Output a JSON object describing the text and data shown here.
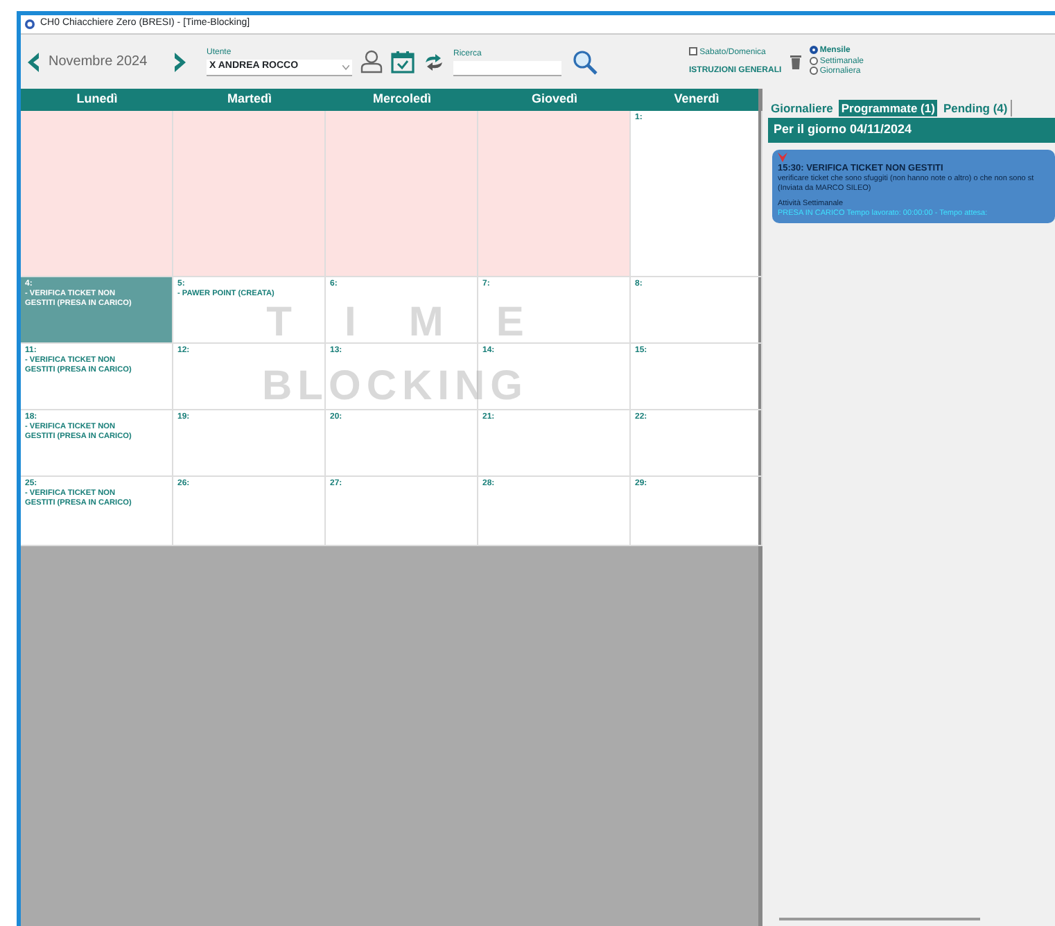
{
  "window": {
    "title": "CH0 Chiacchiere Zero (BRESI) - [Time-Blocking]"
  },
  "toolbar": {
    "month": "Novembre 2024",
    "user_label": "Utente",
    "user_value": "X ANDREA ROCCO",
    "search_label": "Ricerca",
    "weekend": {
      "label": "Sabato/Domenica",
      "checked": false
    },
    "instructions": "ISTRUZIONI GENERALI",
    "views": [
      {
        "label": "Mensile",
        "selected": true
      },
      {
        "label": "Settimanale",
        "selected": false
      },
      {
        "label": "Giornaliera",
        "selected": false
      }
    ]
  },
  "calendar": {
    "weekdays": [
      "Lunedì",
      "Martedì",
      "Mercoledì",
      "Giovedì",
      "Venerdì"
    ],
    "watermark": [
      "TIME",
      "BLOCKING"
    ],
    "weeks": [
      [
        {
          "kind": "other-month"
        },
        {
          "kind": "other-month"
        },
        {
          "kind": "other-month"
        },
        {
          "kind": "other-month"
        },
        {
          "kind": "day",
          "day": "1:",
          "selected": false
        }
      ],
      [
        {
          "kind": "day",
          "day": "4:",
          "entries": [
            "- VERIFICA TICKET NON GESTITI (PRESA IN CARICO)"
          ],
          "selected": true
        },
        {
          "kind": "day",
          "day": "5:",
          "entries": [
            "- PAWER POINT (CREATA)"
          ],
          "selected": false
        },
        {
          "kind": "day",
          "day": "6:",
          "selected": false
        },
        {
          "kind": "day",
          "day": "7:",
          "selected": false
        },
        {
          "kind": "day",
          "day": "8:",
          "selected": false
        }
      ],
      [
        {
          "kind": "day",
          "day": "11:",
          "entries": [
            "- VERIFICA TICKET NON GESTITI (PRESA IN CARICO)"
          ],
          "selected": false
        },
        {
          "kind": "day",
          "day": "12:",
          "selected": false
        },
        {
          "kind": "day",
          "day": "13:",
          "selected": false
        },
        {
          "kind": "day",
          "day": "14:",
          "selected": false
        },
        {
          "kind": "day",
          "day": "15:",
          "selected": false
        }
      ],
      [
        {
          "kind": "day",
          "day": "18:",
          "entries": [
            "- VERIFICA TICKET NON GESTITI (PRESA IN CARICO)"
          ],
          "selected": false
        },
        {
          "kind": "day",
          "day": "19:",
          "selected": false
        },
        {
          "kind": "day",
          "day": "20:",
          "selected": false
        },
        {
          "kind": "day",
          "day": "21:",
          "selected": false
        },
        {
          "kind": "day",
          "day": "22:",
          "selected": false
        }
      ],
      [
        {
          "kind": "day",
          "day": "25:",
          "entries": [
            "- VERIFICA TICKET NON GESTITI (PRESA IN CARICO)"
          ],
          "selected": false
        },
        {
          "kind": "day",
          "day": "26:",
          "selected": false
        },
        {
          "kind": "day",
          "day": "27:",
          "selected": false
        },
        {
          "kind": "day",
          "day": "28:",
          "selected": false
        },
        {
          "kind": "day",
          "day": "29:",
          "selected": false
        }
      ]
    ]
  },
  "panel": {
    "tabs": [
      {
        "label": "Giornaliere",
        "selected": false
      },
      {
        "label": "Programmate (1)",
        "selected": true
      },
      {
        "label": "Pending (4)",
        "selected": false
      }
    ],
    "day_header": "Per il giorno 04/11/2024",
    "activities": [
      {
        "title": "15:30: VERIFICA TICKET NON GESTITI",
        "description": "verificare ticket che sono sfuggiti (non hanno note o altro) o che non sono st",
        "sender": "(Inviata da MARCO SILEO)",
        "type": "Attività Settimanale",
        "status": "PRESA IN CARICO",
        "details": "Tempo lavorato: 00:00:00 - Tempo attesa:"
      }
    ]
  }
}
